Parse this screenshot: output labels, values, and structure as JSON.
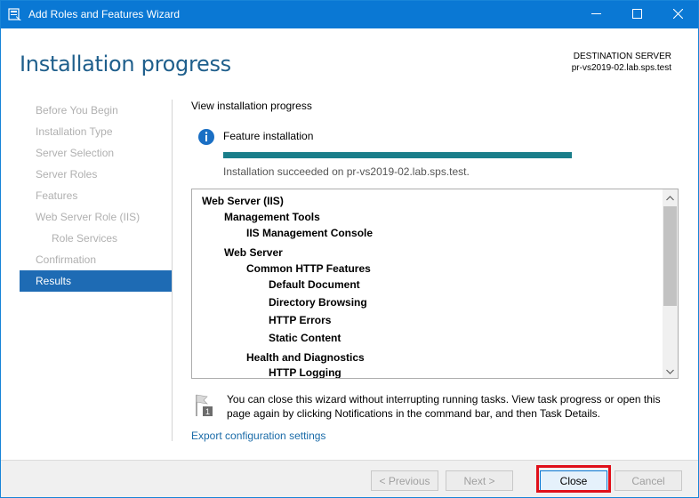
{
  "window": {
    "title": "Add Roles and Features Wizard",
    "accent_color": "#0a78d4",
    "controls": [
      "minimize-icon",
      "maximize-icon",
      "close-icon"
    ]
  },
  "header": {
    "page_title": "Installation progress",
    "destination_label": "DESTINATION SERVER",
    "destination_server": "pr-vs2019-02.lab.sps.test"
  },
  "nav": {
    "items": [
      {
        "label": "Before You Begin",
        "state": "disabled"
      },
      {
        "label": "Installation Type",
        "state": "disabled"
      },
      {
        "label": "Server Selection",
        "state": "disabled"
      },
      {
        "label": "Server Roles",
        "state": "disabled"
      },
      {
        "label": "Features",
        "state": "disabled"
      },
      {
        "label": "Web Server Role (IIS)",
        "state": "disabled"
      },
      {
        "label": "Role Services",
        "state": "disabled"
      },
      {
        "label": "Confirmation",
        "state": "disabled"
      },
      {
        "label": "Results",
        "state": "active"
      }
    ]
  },
  "main": {
    "section_title": "View installation progress",
    "feature_label": "Feature installation",
    "progress": 1.0,
    "status": "Installation succeeded on pr-vs2019-02.lab.sps.test.",
    "results": [
      {
        "text": "Web Server (IIS)",
        "level": 0
      },
      {
        "text": "Management Tools",
        "level": 1
      },
      {
        "text": "IIS Management Console",
        "level": 2
      },
      {
        "text": "Web Server",
        "level": 1
      },
      {
        "text": "Common HTTP Features",
        "level": 2
      },
      {
        "text": "Default Document",
        "level": 3
      },
      {
        "text": "Directory Browsing",
        "level": 3
      },
      {
        "text": "HTTP Errors",
        "level": 3
      },
      {
        "text": "Static Content",
        "level": 3
      },
      {
        "text": "Health and Diagnostics",
        "level": 2
      },
      {
        "text": "HTTP Logging",
        "level": 3
      }
    ],
    "note": "You can close this wizard without interrupting running tasks. View task progress or open this page again by clicking Notifications in the command bar, and then Task Details.",
    "note_icon_badge": "1",
    "export_link": "Export configuration settings"
  },
  "footer": {
    "previous_label": "< Previous",
    "next_label": "Next >",
    "close_label": "Close",
    "cancel_label": "Cancel",
    "highlight_color": "#e0101a"
  }
}
